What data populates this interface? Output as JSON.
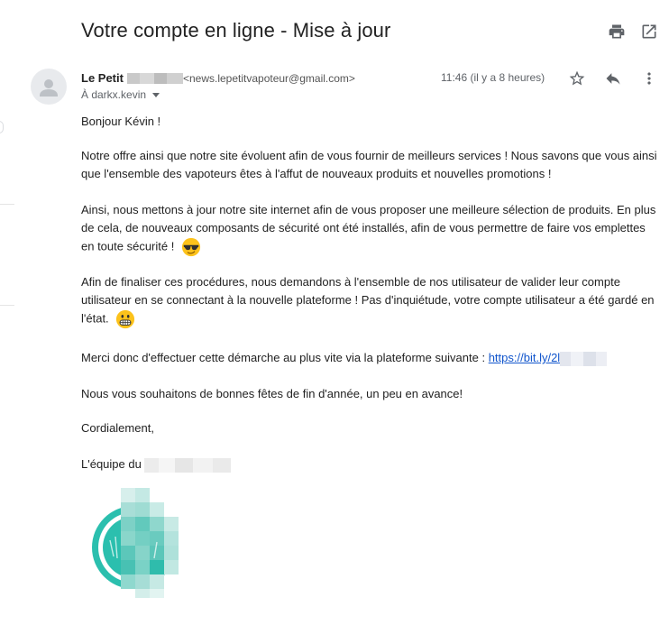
{
  "subject": "Votre compte en ligne - Mise à jour",
  "sender": {
    "name": "Le Petit",
    "email": "<news.lepetitvapoteur@gmail.com>"
  },
  "recipient": "À darkx.kevin",
  "time": "11:46 (il y a 8 heures)",
  "body": {
    "greeting": "Bonjour Kévin !",
    "p1": "Notre offre ainsi que notre site évoluent afin de vous fournir de meilleurs services ! Nous savons que vous ainsi que l'ensemble des vapoteurs êtes à l'affut de nouveaux produits et nouvelles promotions !",
    "p2": "Ainsi, nous mettons à jour notre site internet afin de vous proposer une meilleure sélection de produits. En plus de cela, de nouveaux composants de sécurité ont été installés, afin de vous permettre de faire vos emplettes en toute sécurité !",
    "p3": "Afin de finaliser ces procédures, nous demandons à l'ensemble de nos utilisateur de valider leur compte utilisateur en se connectant à la nouvelle plateforme ! Pas d'inquiétude, votre compte utilisateur a été gardé en l'état.",
    "p4_text": "Merci donc d'effectuer cette démarche au plus vite via la plateforme suivante : ",
    "p4_link": "https://bit.ly/2l",
    "p5": "Nous vous souhaitons de bonnes fêtes de fin d'année, un peu en avance!",
    "closing": "Cordialement,",
    "signature": "L'équipe du"
  },
  "icons": {
    "print": "print-icon",
    "new_window": "open-in-new-window-icon",
    "star": "star-icon",
    "reply": "reply-icon",
    "more": "more-vertical-icon",
    "avatar": "default-avatar-icon",
    "emoji_cool": "sunglasses-emoji-icon",
    "emoji_grin": "grimacing-emoji-icon"
  },
  "colors": {
    "link": "#1155cc",
    "muted": "#5f6368",
    "logo_teal": "#2bbfae"
  }
}
